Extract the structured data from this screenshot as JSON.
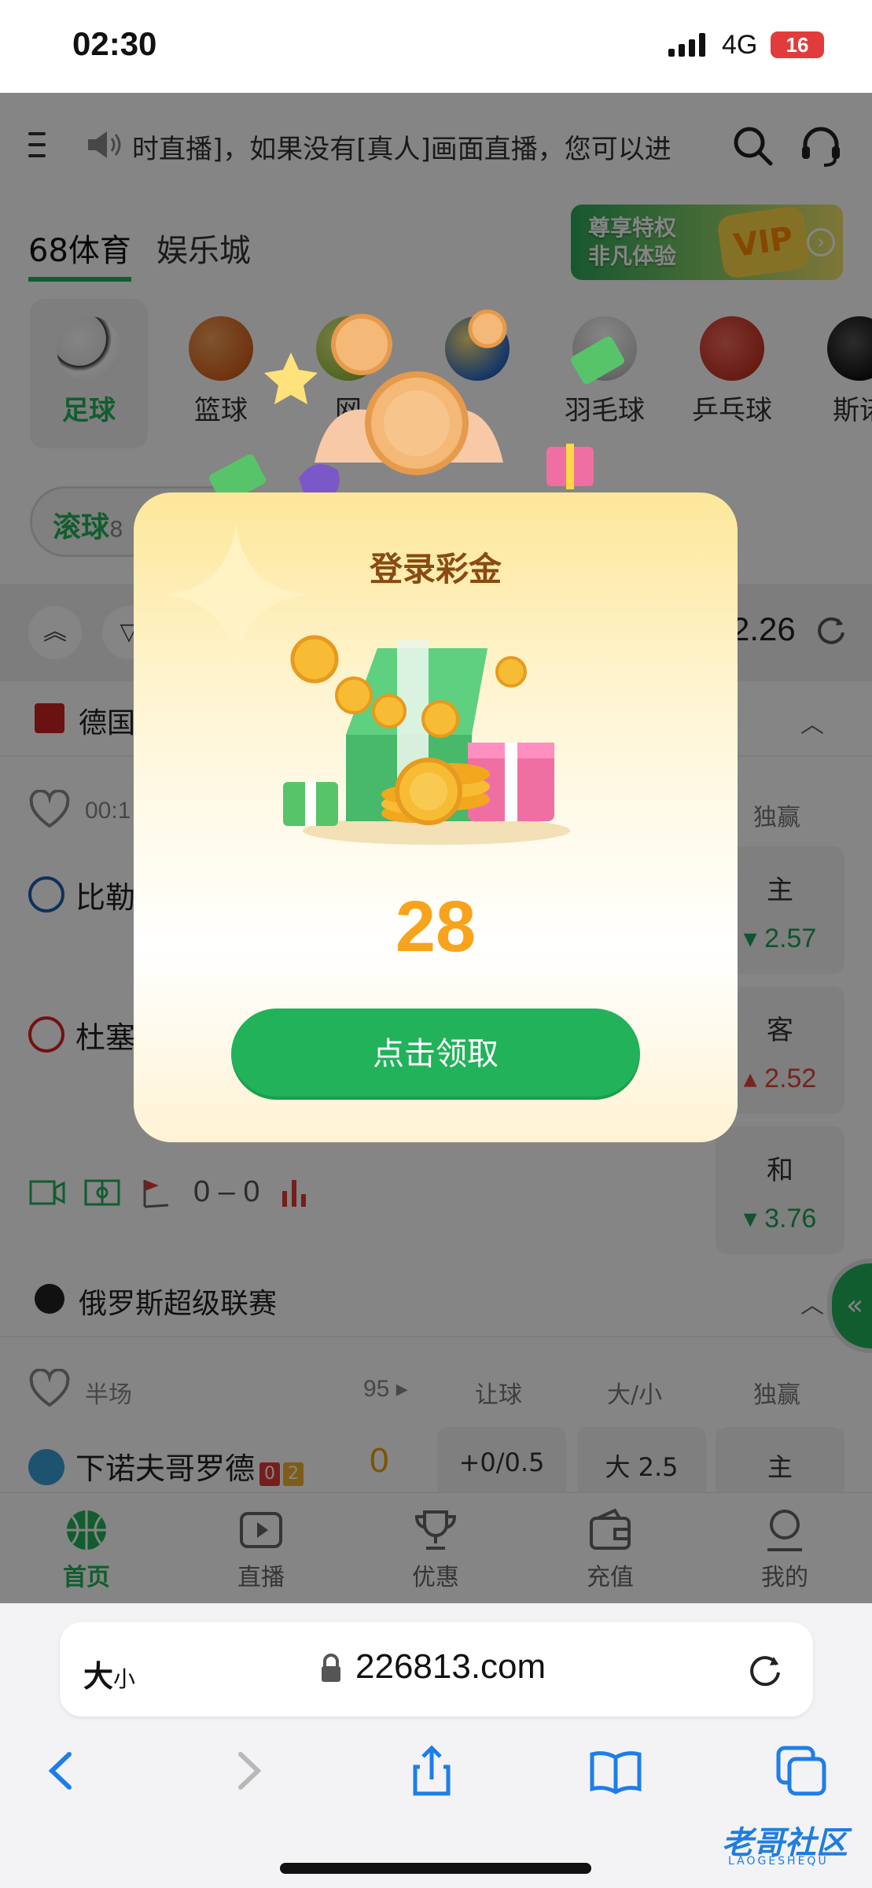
{
  "status_bar": {
    "time": "02:30",
    "network": "4G",
    "battery": "16"
  },
  "header": {
    "marquee_text": "时直播]，如果没有[真人]画面直播，您可以进",
    "tabs": [
      {
        "label": "68体育",
        "active": true
      },
      {
        "label": "娱乐城",
        "active": false
      }
    ],
    "vip_banner": {
      "line1": "尊享特权",
      "line2": "非凡体验",
      "badge": "VIP"
    }
  },
  "sports": [
    {
      "label": "足球",
      "active": true,
      "icon": "soccer-ball-icon"
    },
    {
      "label": "篮球",
      "active": false,
      "icon": "basketball-icon"
    },
    {
      "label": "网",
      "active": false,
      "icon": "tennis-ball-icon"
    },
    {
      "label": "",
      "active": false,
      "icon": "volleyball-icon"
    },
    {
      "label": "羽毛球",
      "active": false,
      "icon": "shuttlecock-icon"
    },
    {
      "label": "乒乓球",
      "active": false,
      "icon": "table-tennis-icon"
    },
    {
      "label": "斯诺",
      "active": false,
      "icon": "snooker-ball-icon"
    }
  ],
  "live_filter": {
    "label": "滚球",
    "count": "8"
  },
  "toolbar": {
    "balance": "2.26"
  },
  "leagues": [
    {
      "name": "德国",
      "match": {
        "time": "00:1",
        "col_header": "独赢",
        "home": "比勒",
        "away": "杜塞",
        "score": "0 – 0",
        "odds": [
          {
            "label": "主",
            "value": "2.57",
            "trend": "down"
          },
          {
            "label": "客",
            "value": "2.52",
            "trend": "up"
          },
          {
            "label": "和",
            "value": "3.76",
            "trend": "down"
          }
        ]
      }
    },
    {
      "name": "俄罗斯超级联赛",
      "match": {
        "time": "半场",
        "minute": "95",
        "col_headers": [
          "让球",
          "大/小",
          "独赢"
        ],
        "home": "下诺夫哥罗德",
        "red_cards": "0",
        "yellow_cards": "2",
        "home_score": "0",
        "odds_row": [
          "+0/0.5",
          "大 2.5",
          "主"
        ]
      }
    }
  ],
  "bottom_nav": [
    {
      "label": "首页",
      "active": true,
      "icon": "basketball-home-icon"
    },
    {
      "label": "直播",
      "active": false,
      "icon": "play-icon"
    },
    {
      "label": "优惠",
      "active": false,
      "icon": "trophy-icon"
    },
    {
      "label": "充值",
      "active": false,
      "icon": "wallet-icon"
    },
    {
      "label": "我的",
      "active": false,
      "icon": "user-icon"
    }
  ],
  "modal": {
    "title": "登录彩金",
    "amount": "28",
    "button": "点击领取"
  },
  "browser": {
    "text_size_big": "大",
    "text_size_small": "小",
    "url": "226813.com"
  },
  "watermark": {
    "text": "老哥社区",
    "sub": "LAOGESHEQU"
  },
  "colors": {
    "accent": "#21b25a",
    "amount": "#f7a31c",
    "title": "#8a4a12"
  }
}
